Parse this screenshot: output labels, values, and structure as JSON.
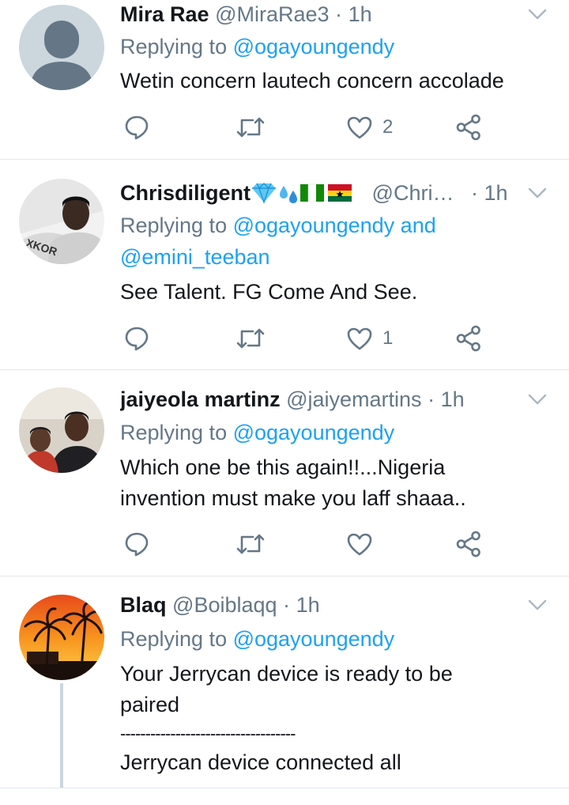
{
  "tweets": [
    {
      "name": "Mira Rae",
      "handle": "@MiraRae3",
      "dot": "·",
      "time": "1h",
      "replying_prefix": "Replying to ",
      "replying_to": "@ogayoungendy",
      "replying_and": "",
      "replying_to_2": "",
      "text": [
        "Wetin concern lautech concern accolade"
      ],
      "likes": "2",
      "avatar": "default-avatar"
    },
    {
      "name": "Chrisdiligent",
      "name_emoji": [
        "gem-emoji",
        "sweat-droplets-emoji",
        "nigeria-flag-emoji",
        "ghana-flag-emoji"
      ],
      "handle": "@Chri…",
      "dot": "·",
      "time": "1h",
      "replying_prefix": "Replying to ",
      "replying_to": "@ogayoungendy",
      "replying_and": " and",
      "replying_to_2": "@emini_teeban",
      "text": [
        "See Talent. FG Come And See."
      ],
      "likes": "1",
      "avatar": "photo-avatar"
    },
    {
      "name": "jaiyeola martinz",
      "handle": "@jaiyemartins",
      "dot": "·",
      "time": "1h",
      "replying_prefix": "Replying to ",
      "replying_to": "@ogayoungendy",
      "text": [
        "Which one be this again!!...Nigeria",
        "invention must make you laff shaaa.."
      ],
      "likes": "",
      "avatar": "photo-avatar"
    },
    {
      "name": "Blaq",
      "handle": "@Boiblaqq",
      "dot": "·",
      "time": "1h",
      "replying_prefix": "Replying to ",
      "replying_to": "@ogayoungendy",
      "text": [
        "Your Jerrycan device is ready to be",
        "paired",
        "-----------------------------------",
        "Jerrycan device connected all"
      ],
      "avatar": "palm-sunset-avatar"
    }
  ],
  "colors": {
    "link": "#1da1f2",
    "secondary_text": "#657786",
    "divider": "#e1e8ed",
    "icon": "#657786"
  },
  "icons": [
    "chevron-down-icon",
    "reply-icon",
    "retweet-icon",
    "like-icon",
    "share-icon"
  ]
}
